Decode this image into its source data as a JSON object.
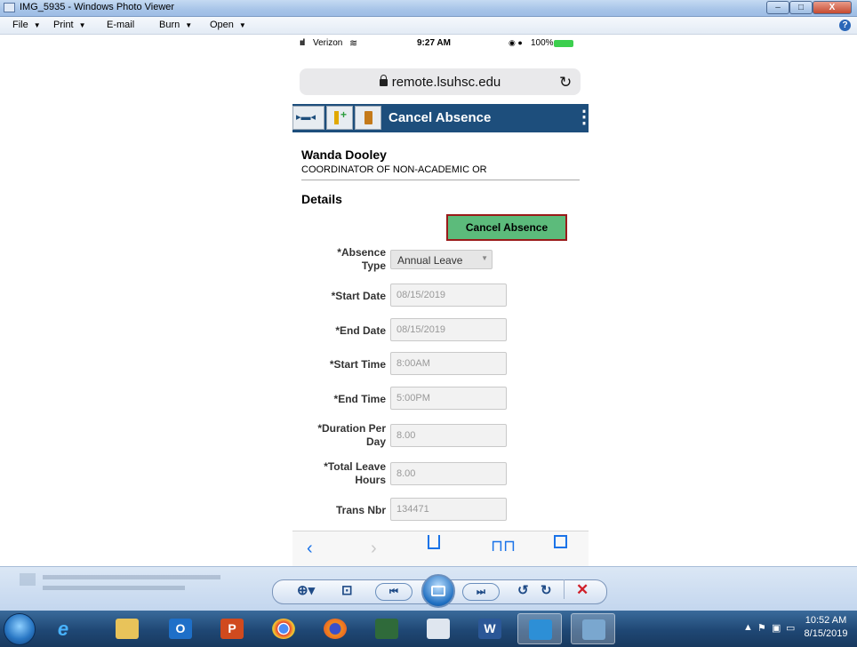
{
  "window": {
    "title": "IMG_5935 - Windows Photo Viewer",
    "min": "–",
    "max": "□",
    "close": "X"
  },
  "menu": {
    "file": "File",
    "print": "Print",
    "email": "E-mail",
    "burn": "Burn",
    "open": "Open",
    "help": "?"
  },
  "phone": {
    "carrier": "Verizon",
    "time": "9:27 AM",
    "battery": "100%",
    "url": "remote.lsuhsc.edu",
    "page_title": "Cancel Absence",
    "employee_name": "Wanda Dooley",
    "employee_title": "COORDINATOR OF NON-ACADEMIC OR",
    "details_heading": "Details",
    "cancel_button": "Cancel Absence",
    "fields": {
      "absence_type_label_1": "*Absence",
      "absence_type_label_2": "Type",
      "absence_type_value": "Annual Leave",
      "start_date_label": "*Start Date",
      "start_date_value": "08/15/2019",
      "end_date_label": "*End Date",
      "end_date_value": "08/15/2019",
      "start_time_label": "*Start Time",
      "start_time_value": "8:00AM",
      "end_time_label": "*End Time",
      "end_time_value": "5:00PM",
      "duration_label_1": "*Duration Per",
      "duration_label_2": "Day",
      "duration_value": "8.00",
      "total_leave_label_1": "*Total Leave",
      "total_leave_label_2": "Hours",
      "total_leave_value": "8.00",
      "trans_nbr_label": "Trans Nbr",
      "trans_nbr_value": "134471"
    }
  },
  "taskbar": {
    "time": "10:52 AM",
    "date": "8/15/2019"
  },
  "icons": {
    "accent": "#1d4e7c",
    "button_green": "#5cbb7b"
  }
}
